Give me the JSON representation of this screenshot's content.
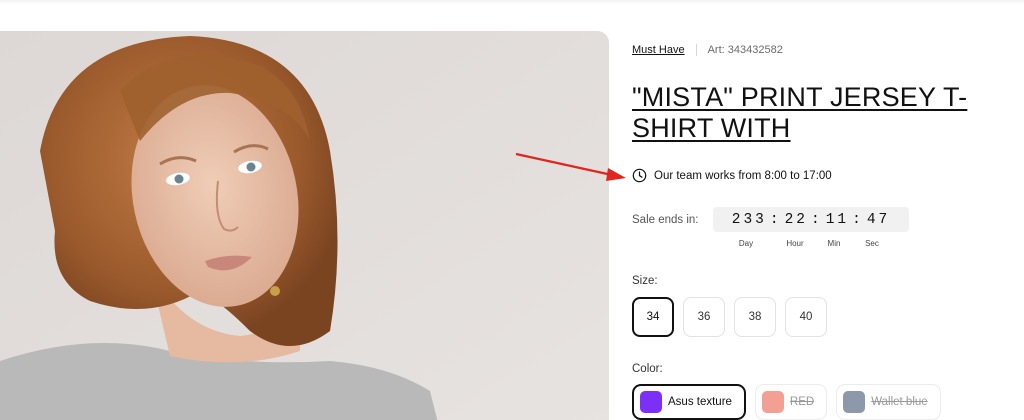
{
  "product": {
    "collection_link": "Must Have",
    "article": "Art: 343432582",
    "title": "\"MISTA\" PRINT JERSEY T-SHIRT WITH",
    "hours_note": "Our team works from 8:00 to 17:00",
    "icons": {
      "clock": "clock-icon",
      "annotation": "red-arrow-icon"
    }
  },
  "sale": {
    "label": "Sale ends in:",
    "days": "233",
    "hours": "22",
    "minutes": "11",
    "seconds": "47",
    "unit_labels": {
      "day": "Day",
      "hour": "Hour",
      "min": "Min",
      "sec": "Sec"
    }
  },
  "size": {
    "label": "Size:",
    "options": [
      "34",
      "36",
      "38",
      "40"
    ],
    "selected": "34"
  },
  "color": {
    "label": "Color:",
    "options": [
      {
        "name": "Asus texture",
        "swatch": "#7b2ff7",
        "selected": true,
        "available": true
      },
      {
        "name": "RED",
        "swatch": "#f2a093",
        "selected": false,
        "available": false
      },
      {
        "name": "Wallet blue",
        "swatch": "#8d98aa",
        "selected": false,
        "available": false
      }
    ]
  },
  "colors": {
    "accent": "#111111",
    "arrow": "#e0261f",
    "timer_bg": "#f1f1f1"
  }
}
